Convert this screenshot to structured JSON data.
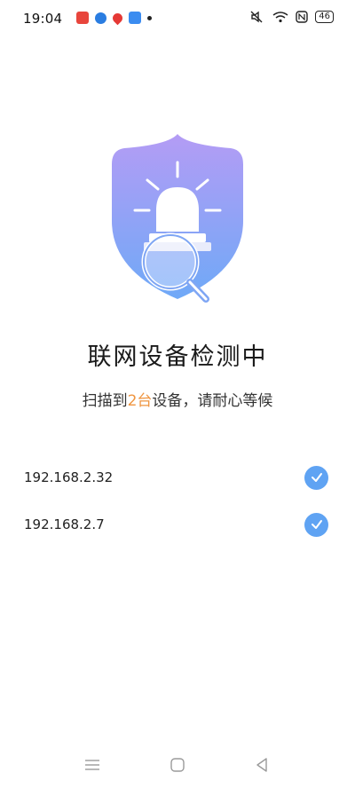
{
  "status_bar": {
    "time": "19:04",
    "notification_icons": [
      "news-app-icon",
      "browser-app-icon",
      "map-pin-app-icon",
      "reader-app-icon"
    ],
    "system_icons": [
      "mute-icon",
      "wifi-icon",
      "nfc-icon"
    ],
    "battery": "46"
  },
  "page": {
    "title": "联网设备检测中",
    "subtitle_prefix": "扫描到",
    "subtitle_count": "2台",
    "subtitle_suffix": "设备，请耐心等候"
  },
  "devices": [
    {
      "ip": "192.168.2.32",
      "status": "checked"
    },
    {
      "ip": "192.168.2.7",
      "status": "checked"
    }
  ],
  "colors": {
    "accent": "#ef9540",
    "check": "#5fa3f3",
    "shield_top": "#b49cf5",
    "shield_bottom": "#6fa9f7"
  },
  "nav_bar": {
    "items": [
      "menu-icon",
      "home-icon",
      "back-icon"
    ]
  }
}
